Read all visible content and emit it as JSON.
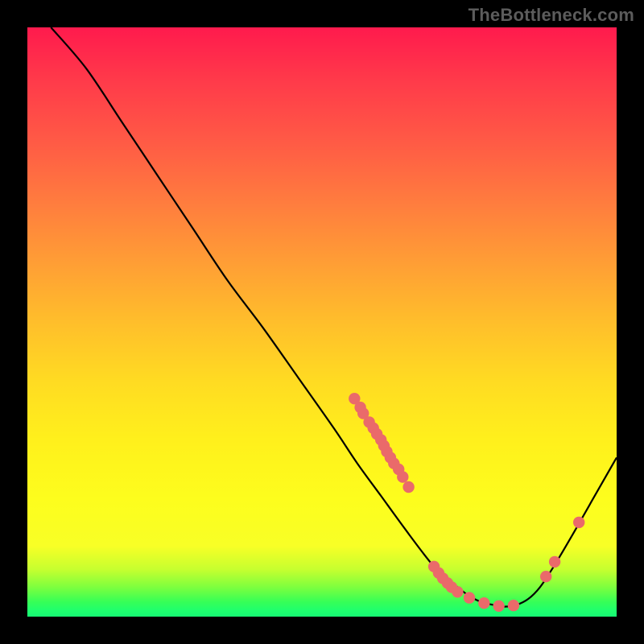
{
  "watermark": "TheBottleneck.com",
  "chart_data": {
    "type": "line",
    "title": "",
    "xlabel": "",
    "ylabel": "",
    "xlim": [
      0,
      100
    ],
    "ylim": [
      0,
      100
    ],
    "curve": [
      {
        "x": 4,
        "y": 100
      },
      {
        "x": 10,
        "y": 93
      },
      {
        "x": 16,
        "y": 84
      },
      {
        "x": 22,
        "y": 75
      },
      {
        "x": 28,
        "y": 66
      },
      {
        "x": 34,
        "y": 57
      },
      {
        "x": 40,
        "y": 49
      },
      {
        "x": 46,
        "y": 40.5
      },
      {
        "x": 52,
        "y": 32
      },
      {
        "x": 56,
        "y": 26
      },
      {
        "x": 60,
        "y": 20.5
      },
      {
        "x": 64,
        "y": 15
      },
      {
        "x": 67,
        "y": 11
      },
      {
        "x": 69,
        "y": 8.5
      },
      {
        "x": 71,
        "y": 6.5
      },
      {
        "x": 73,
        "y": 5
      },
      {
        "x": 75,
        "y": 3.5
      },
      {
        "x": 77,
        "y": 2.5
      },
      {
        "x": 79,
        "y": 2
      },
      {
        "x": 81,
        "y": 1.7
      },
      {
        "x": 83,
        "y": 2
      },
      {
        "x": 85,
        "y": 3
      },
      {
        "x": 87,
        "y": 5
      },
      {
        "x": 89,
        "y": 8
      },
      {
        "x": 92,
        "y": 13
      },
      {
        "x": 96,
        "y": 20
      },
      {
        "x": 100,
        "y": 27
      }
    ],
    "series": [
      {
        "name": "highlighted-points",
        "points": [
          {
            "x": 55.5,
            "y": 37
          },
          {
            "x": 56.5,
            "y": 35.5
          },
          {
            "x": 57,
            "y": 34.5
          },
          {
            "x": 58,
            "y": 33
          },
          {
            "x": 58.7,
            "y": 32
          },
          {
            "x": 59.3,
            "y": 31
          },
          {
            "x": 60,
            "y": 30
          },
          {
            "x": 60.5,
            "y": 29
          },
          {
            "x": 61,
            "y": 28
          },
          {
            "x": 61.6,
            "y": 27
          },
          {
            "x": 62.2,
            "y": 26
          },
          {
            "x": 63,
            "y": 25
          },
          {
            "x": 63.7,
            "y": 23.7
          },
          {
            "x": 64.7,
            "y": 22
          },
          {
            "x": 69,
            "y": 8.5
          },
          {
            "x": 69.8,
            "y": 7.4
          },
          {
            "x": 70.5,
            "y": 6.5
          },
          {
            "x": 71.3,
            "y": 5.7
          },
          {
            "x": 72,
            "y": 5
          },
          {
            "x": 73,
            "y": 4.2
          },
          {
            "x": 75,
            "y": 3.2
          },
          {
            "x": 77.5,
            "y": 2.3
          },
          {
            "x": 80,
            "y": 1.8
          },
          {
            "x": 82.5,
            "y": 1.9
          },
          {
            "x": 88,
            "y": 6.8
          },
          {
            "x": 89.5,
            "y": 9.3
          },
          {
            "x": 93.6,
            "y": 16
          }
        ]
      }
    ],
    "colors": {
      "curve": "#000000",
      "dots": "#ea6a6a",
      "gradient_top": "#ff1a4d",
      "gradient_bottom": "#17f873"
    }
  }
}
